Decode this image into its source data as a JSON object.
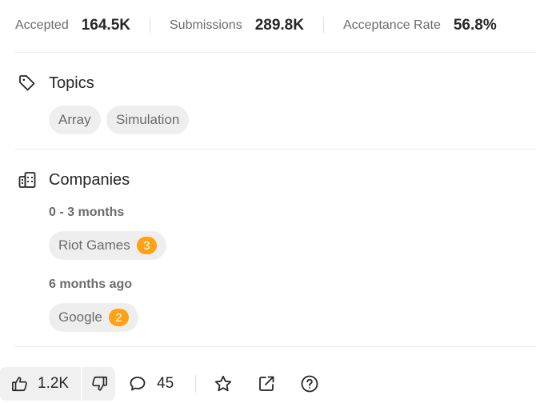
{
  "stats": [
    {
      "label": "Accepted",
      "value": "164.5K"
    },
    {
      "label": "Submissions",
      "value": "289.8K"
    },
    {
      "label": "Acceptance Rate",
      "value": "56.8%"
    }
  ],
  "topics": {
    "title": "Topics",
    "icon": "tag-icon",
    "tags": [
      "Array",
      "Simulation"
    ]
  },
  "companies": {
    "title": "Companies",
    "icon": "building-icon",
    "groups": [
      {
        "label": "0 - 3 months",
        "items": [
          {
            "name": "Riot Games",
            "count": "3"
          }
        ]
      },
      {
        "label": "6 months ago",
        "items": [
          {
            "name": "Google",
            "count": "2"
          }
        ]
      }
    ]
  },
  "actions": {
    "likes": "1.2K",
    "comments": "45",
    "icons": [
      "thumbs-up-icon",
      "thumbs-down-icon",
      "comment-icon",
      "star-icon",
      "share-icon",
      "help-icon"
    ]
  },
  "colors": {
    "badge": "#ffa116",
    "chip_bg": "#eeeeee",
    "muted_text": "#6b6b6b"
  }
}
